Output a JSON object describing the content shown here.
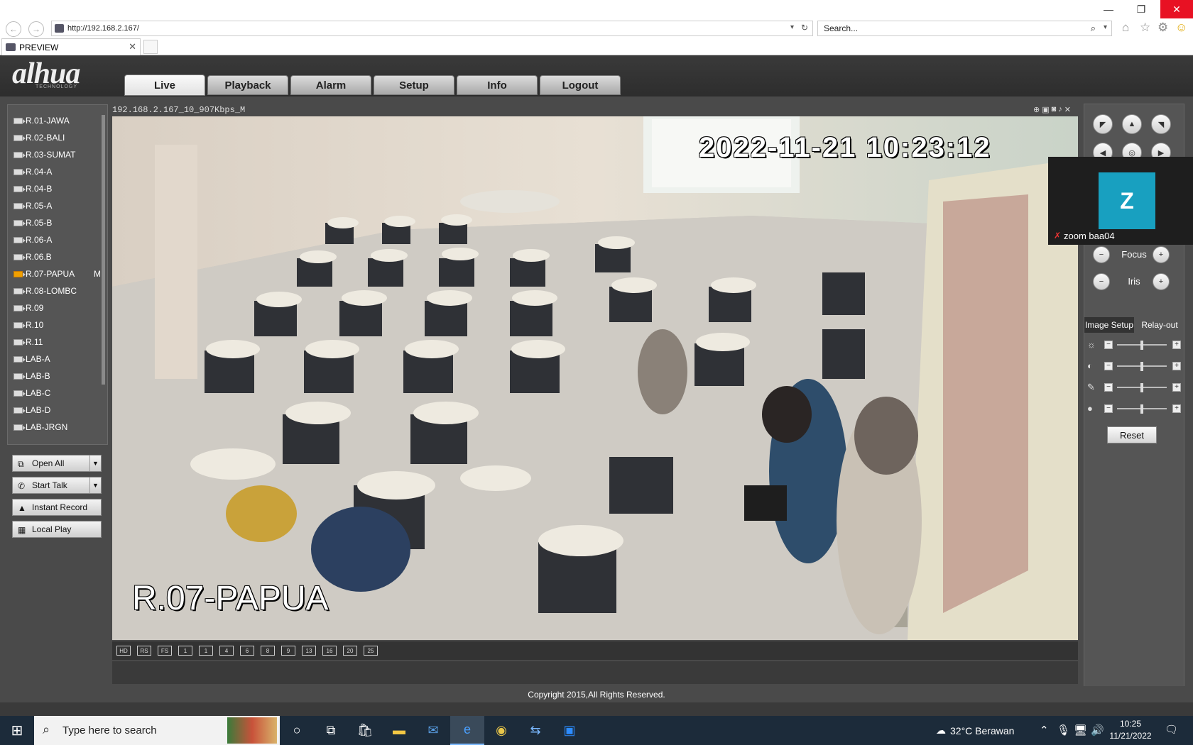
{
  "browser": {
    "url": "http://192.168.2.167/",
    "search_placeholder": "Search...",
    "tab_title": "PREVIEW"
  },
  "app": {
    "logo": "alhua",
    "logo_sub": "TECHNOLOGY",
    "nav": [
      "Live",
      "Playback",
      "Alarm",
      "Setup",
      "Info",
      "Logout"
    ],
    "active_nav": "Live",
    "cameras": [
      "R.01-JAWA",
      "R.02-BALI",
      "R.03-SUMAT",
      "R.04-A",
      "R.04-B",
      "R.05-A",
      "R.05-B",
      "R.06-A",
      "R.06.B",
      "R.07-PAPUA",
      "R.08-LOMBC",
      "R.09",
      "R.10",
      "R.11",
      "LAB-A",
      "LAB-B",
      "LAB-C",
      "LAB-D",
      "LAB-JRGN"
    ],
    "active_camera": "R.07-PAPUA",
    "active_camera_flag": "M",
    "buttons": {
      "open_all": "Open All",
      "start_talk": "Start Talk",
      "instant_record": "Instant Record",
      "local_play": "Local Play"
    },
    "stream_info": "192.168.2.167_10_907Kbps_M",
    "osd_time": "2022-11-21  10:23:12",
    "osd_name": "R.07-PAPUA",
    "layout_buttons": [
      "HD",
      "RS",
      "FS",
      "1",
      "1",
      "4",
      "6",
      "8",
      "9",
      "13",
      "16",
      "20",
      "25"
    ],
    "controls": {
      "focus": "Focus",
      "iris": "Iris"
    },
    "right_tabs": [
      "Image Setup",
      "Relay-out"
    ],
    "sliders": [
      {
        "icon": "brightness-icon",
        "value": 50
      },
      {
        "icon": "contrast-icon",
        "value": 50
      },
      {
        "icon": "saturation-icon",
        "value": 50
      },
      {
        "icon": "color-icon",
        "value": 50
      }
    ],
    "reset": "Reset",
    "copyright": "Copyright 2015,All Rights Reserved."
  },
  "zoom": {
    "avatar": "Z",
    "name": "zoom baa04"
  },
  "taskbar": {
    "search_placeholder": "Type here to search",
    "weather": "32°C  Berawan",
    "time": "10:25",
    "date": "11/21/2022"
  }
}
